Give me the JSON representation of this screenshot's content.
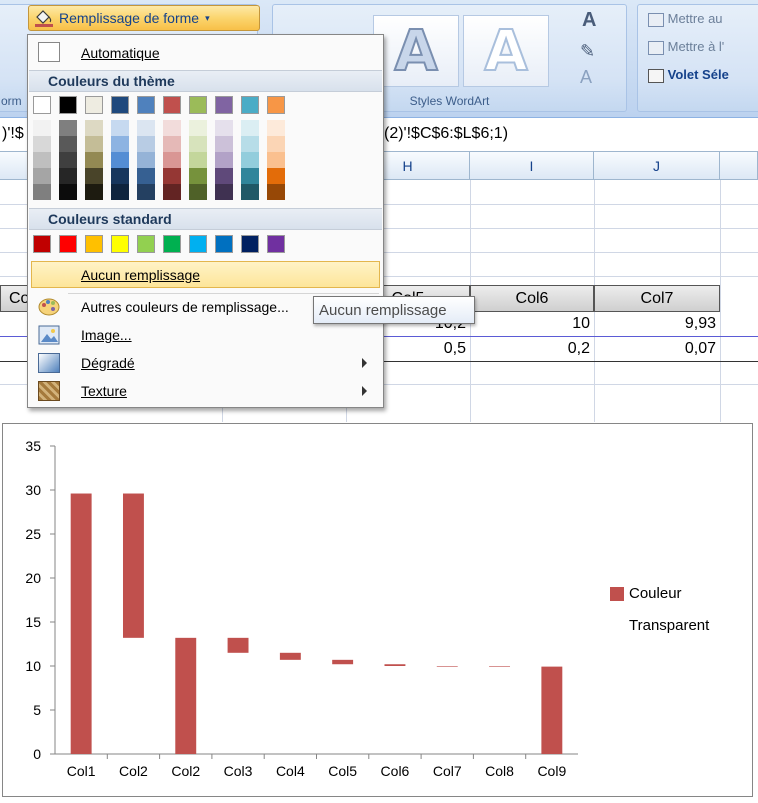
{
  "ribbon": {
    "fill_button_label": "Remplissage de forme",
    "left_group_label": "orm",
    "wordart_group_label": "Styles WordArt",
    "wordart_glyph": "A",
    "text_fill_glyph": "A",
    "right_buttons": [
      "Mettre au",
      "Mettre à l'",
      "Volet Séle"
    ]
  },
  "formula_bar": {
    "left_text": ")'!$",
    "right_text": "(2)'!$C$6:$L$6;1)"
  },
  "grid": {
    "column_headers": [
      "H",
      "I",
      "J"
    ],
    "table_headers": [
      "Co",
      "Col5",
      "Col6",
      "Col7"
    ],
    "rows": [
      [
        "10,2",
        "10",
        "9,93"
      ],
      [
        "0,5",
        "0,2",
        "0,07"
      ]
    ]
  },
  "menu": {
    "automatic_label": "Automatique",
    "theme_colors_label": "Couleurs du thème",
    "standard_colors_label": "Couleurs standard",
    "no_fill_label": "Aucun remplissage",
    "more_colors_label": "Autres couleurs de remplissage...",
    "picture_label": "Image...",
    "gradient_label": "Dégradé",
    "texture_label": "Texture",
    "theme_colors": [
      "#ffffff",
      "#000000",
      "#eeece1",
      "#1f497d",
      "#4f81bd",
      "#c0504d",
      "#9bbb59",
      "#8064a2",
      "#4bacc6",
      "#f79646"
    ],
    "theme_tints": [
      [
        "#f2f2f2",
        "#d8d8d8",
        "#bfbfbf",
        "#a5a5a5",
        "#7f7f7f"
      ],
      [
        "#7f7f7f",
        "#595959",
        "#3f3f3f",
        "#262626",
        "#0c0c0c"
      ],
      [
        "#ddd9c3",
        "#c4bd97",
        "#938953",
        "#494429",
        "#1d1b10"
      ],
      [
        "#c6d9f0",
        "#8db3e2",
        "#548dd4",
        "#17365d",
        "#0f243e"
      ],
      [
        "#dbe5f1",
        "#b8cce4",
        "#95b3d7",
        "#366092",
        "#244061"
      ],
      [
        "#f2dcdb",
        "#e5b9b7",
        "#d99694",
        "#953734",
        "#632423"
      ],
      [
        "#ebf1dd",
        "#d7e3bc",
        "#c3d69b",
        "#76923c",
        "#4f6128"
      ],
      [
        "#e5e0ec",
        "#ccc1d9",
        "#b2a2c7",
        "#5f497a",
        "#3f3151"
      ],
      [
        "#dbeef3",
        "#b7dde8",
        "#92cddc",
        "#31859b",
        "#205867"
      ],
      [
        "#fdeada",
        "#fbd5b5",
        "#fac08f",
        "#e36c09",
        "#974806"
      ]
    ],
    "standard_colors": [
      "#c00000",
      "#ff0000",
      "#ffc000",
      "#ffff00",
      "#92d050",
      "#00b050",
      "#00b0f0",
      "#0070c0",
      "#002060",
      "#7030a0"
    ]
  },
  "tooltip": {
    "text": "Aucun remplissage"
  },
  "icons": {
    "fill_bucket": "paint-bucket-icon",
    "palette": "color-palette-icon",
    "picture": "picture-icon",
    "gradient": "gradient-icon",
    "texture": "texture-icon"
  },
  "colors": {
    "bar_color": "#c0504d",
    "highlight": "#fbd56e"
  },
  "chart_data": {
    "type": "bar",
    "stacked": true,
    "categories": [
      "Col1",
      "Col2",
      "Col2",
      "Col3",
      "Col4",
      "Col5",
      "Col6",
      "Col7",
      "Col8",
      "Col9"
    ],
    "series": [
      {
        "name": "Transparent",
        "values": [
          0,
          13.2,
          0,
          11.5,
          10.7,
          10.2,
          10.0,
          9.93,
          9.93,
          0
        ]
      },
      {
        "name": "Couleur",
        "values": [
          29.6,
          16.4,
          13.2,
          1.7,
          0.8,
          0.5,
          0.2,
          0.07,
          0.07,
          9.93
        ]
      }
    ],
    "ylim": [
      0,
      35
    ],
    "yticks": [
      0,
      5,
      10,
      15,
      20,
      25,
      30,
      35
    ],
    "grid": false,
    "legend_position": "right",
    "title": "",
    "xlabel": "",
    "ylabel": ""
  }
}
